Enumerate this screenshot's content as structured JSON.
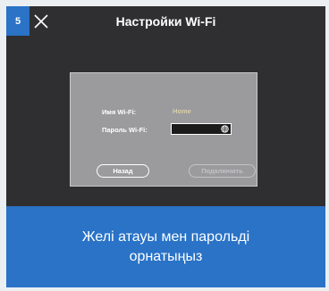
{
  "step": {
    "number": "5"
  },
  "header": {
    "title": "Настройки Wi-Fi"
  },
  "dialog": {
    "ssid_label": "Имя Wi-Fi:",
    "ssid_value": "Home",
    "password_label": "Пароль Wi-Fi:",
    "password_value": "",
    "back_label": "Назад",
    "connect_label": "Подключить"
  },
  "caption": {
    "text": "Желі атауы мен парольді орнатыңыз"
  },
  "colors": {
    "accent": "#2a73c7",
    "panel": "#2f2f31",
    "dialog": "#9b9b9e"
  },
  "icons": {
    "close": "close-icon",
    "password_toggle": "globe-icon"
  }
}
